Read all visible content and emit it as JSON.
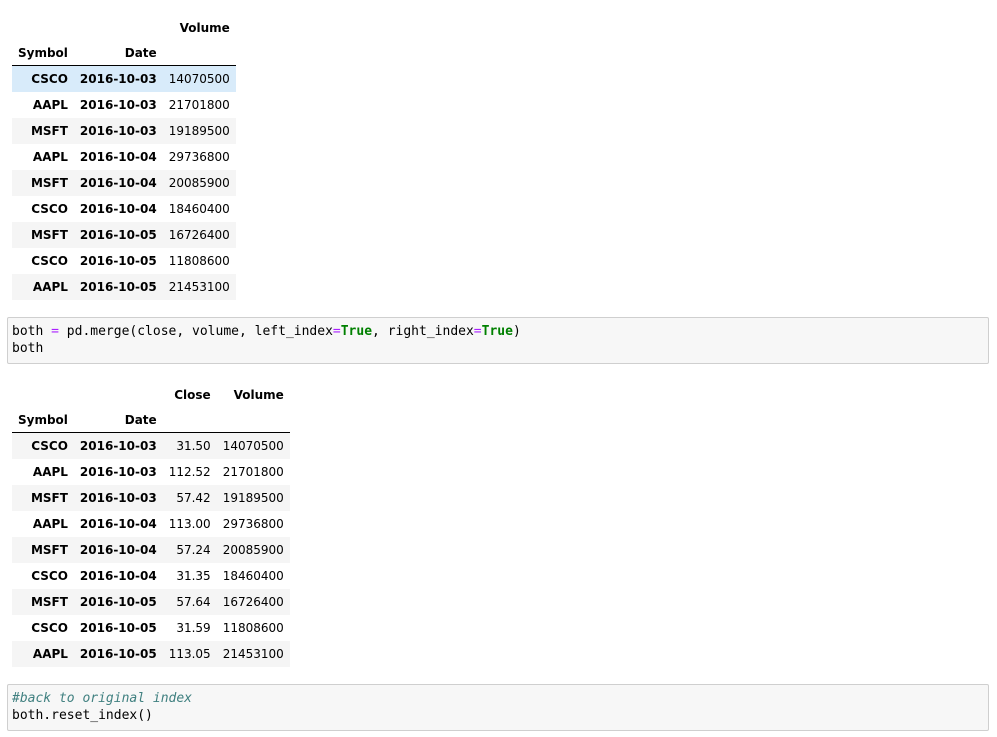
{
  "table1": {
    "value_columns": [
      "Volume"
    ],
    "index_names": [
      "Symbol",
      "Date"
    ],
    "rows": [
      {
        "symbol": "CSCO",
        "date": "2016-10-03",
        "volume": "14070500"
      },
      {
        "symbol": "AAPL",
        "date": "2016-10-03",
        "volume": "21701800"
      },
      {
        "symbol": "MSFT",
        "date": "2016-10-03",
        "volume": "19189500"
      },
      {
        "symbol": "AAPL",
        "date": "2016-10-04",
        "volume": "29736800"
      },
      {
        "symbol": "MSFT",
        "date": "2016-10-04",
        "volume": "20085900"
      },
      {
        "symbol": "CSCO",
        "date": "2016-10-04",
        "volume": "18460400"
      },
      {
        "symbol": "MSFT",
        "date": "2016-10-05",
        "volume": "16726400"
      },
      {
        "symbol": "CSCO",
        "date": "2016-10-05",
        "volume": "11808600"
      },
      {
        "symbol": "AAPL",
        "date": "2016-10-05",
        "volume": "21453100"
      }
    ]
  },
  "cell1": {
    "line1": {
      "a": "both ",
      "op1": "=",
      "b": " pd.merge(close, volume, left_index",
      "op2": "=",
      "kw1": "True",
      "c": ", right_index",
      "op3": "=",
      "kw2": "True",
      "d": ")"
    },
    "line2": "both"
  },
  "table2": {
    "value_columns": [
      "Close",
      "Volume"
    ],
    "index_names": [
      "Symbol",
      "Date"
    ],
    "rows": [
      {
        "symbol": "CSCO",
        "date": "2016-10-03",
        "close": "31.50",
        "volume": "14070500"
      },
      {
        "symbol": "AAPL",
        "date": "2016-10-03",
        "close": "112.52",
        "volume": "21701800"
      },
      {
        "symbol": "MSFT",
        "date": "2016-10-03",
        "close": "57.42",
        "volume": "19189500"
      },
      {
        "symbol": "AAPL",
        "date": "2016-10-04",
        "close": "113.00",
        "volume": "29736800"
      },
      {
        "symbol": "MSFT",
        "date": "2016-10-04",
        "close": "57.24",
        "volume": "20085900"
      },
      {
        "symbol": "CSCO",
        "date": "2016-10-04",
        "close": "31.35",
        "volume": "18460400"
      },
      {
        "symbol": "MSFT",
        "date": "2016-10-05",
        "close": "57.64",
        "volume": "16726400"
      },
      {
        "symbol": "CSCO",
        "date": "2016-10-05",
        "close": "31.59",
        "volume": "11808600"
      },
      {
        "symbol": "AAPL",
        "date": "2016-10-05",
        "close": "113.05",
        "volume": "21453100"
      }
    ]
  },
  "cell2": {
    "comment": "#back to original index",
    "line2": "both.reset_index()"
  }
}
